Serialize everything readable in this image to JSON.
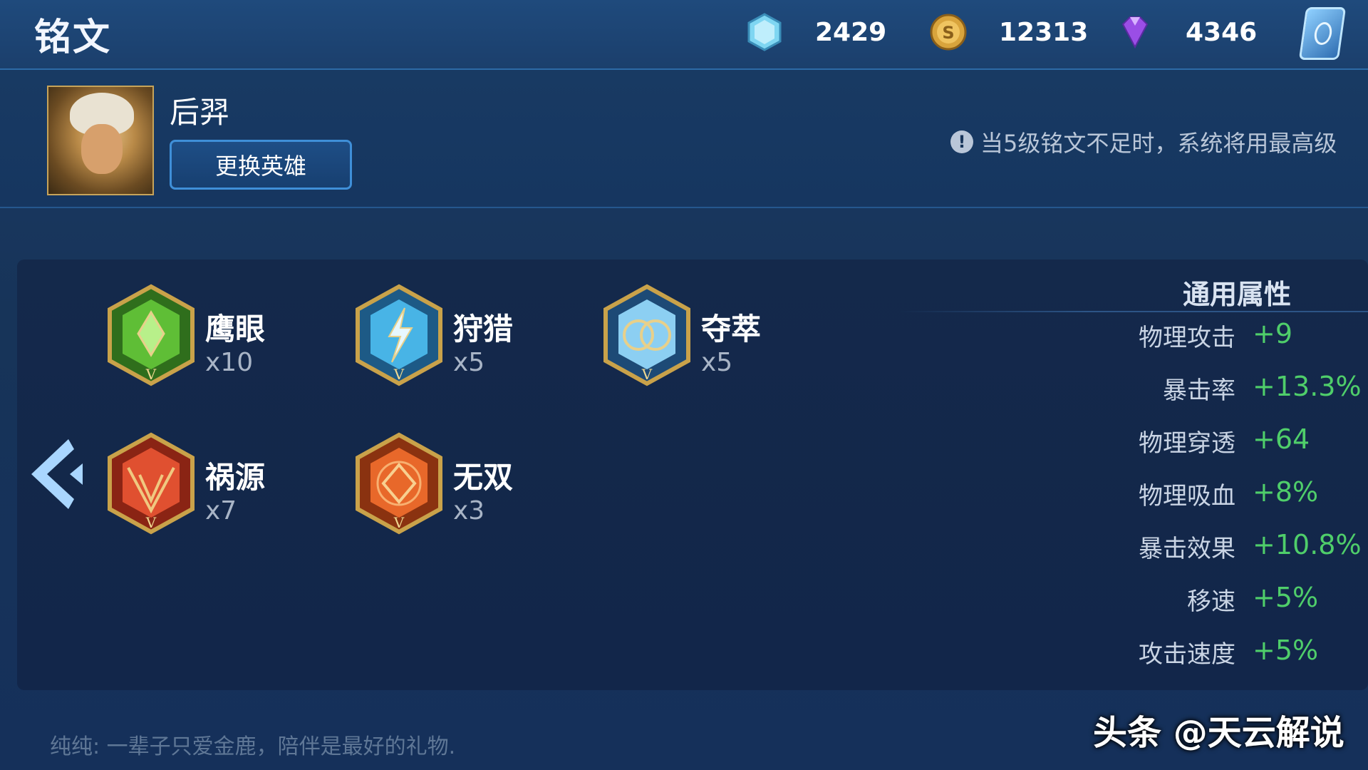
{
  "header": {
    "title": "铭文",
    "currencies": [
      {
        "icon": "hex-crystal-icon",
        "value": "2429"
      },
      {
        "icon": "gold-coin-icon",
        "value": "12313"
      },
      {
        "icon": "purple-diamond-icon",
        "value": "4346"
      }
    ],
    "card_icon": "rune-card-icon"
  },
  "hero": {
    "name": "后羿",
    "change_label": "更换英雄",
    "notice": "当5级铭文不足时，系统将用最高级"
  },
  "runes": [
    {
      "name": "鹰眼",
      "count": "x10",
      "color": "#4a9a2a"
    },
    {
      "name": "狩猎",
      "count": "x5",
      "color": "#3aa6d8"
    },
    {
      "name": "夺萃",
      "count": "x5",
      "color": "#6fb6e6"
    },
    {
      "name": "祸源",
      "count": "x7",
      "color": "#d8462a"
    },
    {
      "name": "无双",
      "count": "x3",
      "color": "#e05a1e"
    }
  ],
  "attributes": {
    "title": "通用属性",
    "items": [
      {
        "label": "物理攻击",
        "value": "+9"
      },
      {
        "label": "暴击率",
        "value": "+13.3%"
      },
      {
        "label": "物理穿透",
        "value": "+64"
      },
      {
        "label": "物理吸血",
        "value": "+8%"
      },
      {
        "label": "暴击效果",
        "value": "+10.8%"
      },
      {
        "label": "移速",
        "value": "+5%"
      },
      {
        "label": "攻击速度",
        "value": "+5%"
      }
    ]
  },
  "footer": {
    "quote": "纯纯: 一辈子只爱金鹿，陪伴是最好的礼物.",
    "watermark": "头条 @天云解说"
  }
}
